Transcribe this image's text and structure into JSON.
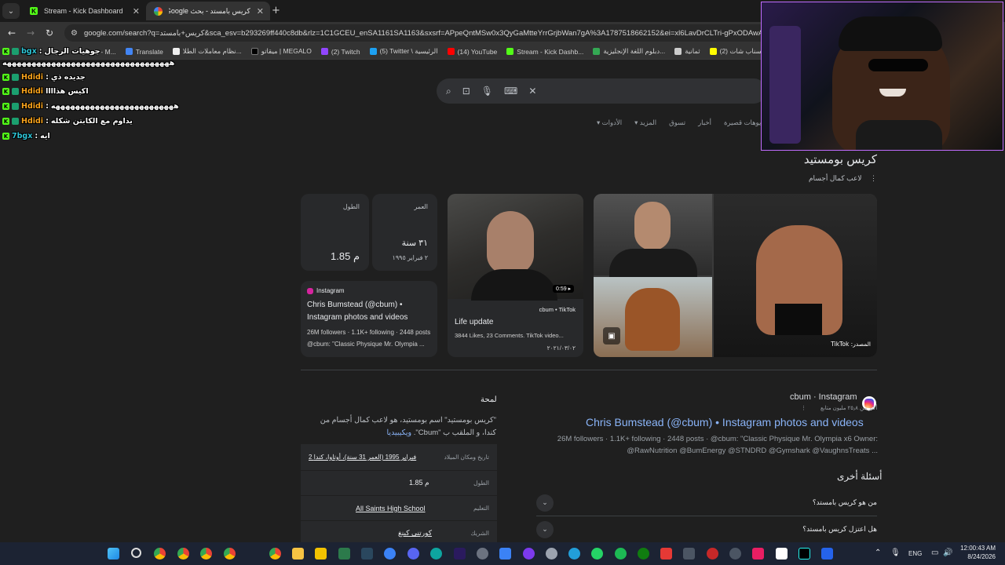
{
  "tabs": [
    {
      "title": "Stream - Kick Dashboard",
      "active": false
    },
    {
      "title": "كريس بامستد - بحث Google",
      "active": true
    }
  ],
  "address": {
    "url": "google.com/search?q=كريس+بامستد&sca_esv=b293269ff440c8db&rlz=1C1GCEU_enSA1161SA1163&sxsrf=APpeQntMSw0x3QyGaMtteYrrGrjbWan7gA%3A1787518662152&ei=xl6LavDrCLTri-gPxODAwA8&biw="
  },
  "bookmarks": [
    "ents - M...",
    "Translate",
    "نظام معاملات الطلا...",
    "ميقاتو | MEGALO",
    "(2) Twitch",
    "(5) Twitter \\ الرئيسية",
    "(14) YouTube",
    "Stream - Kick Dashb...",
    "دبلوم اللغة الإنجليزية...",
    "ثمانية",
    "(2) سناب شات"
  ],
  "chat": [
    {
      "user": "bgx",
      "text": "جوهيات الرجال"
    },
    {
      "user": "",
      "text": "ههههههههههههههههههههههههههههههههههه"
    },
    {
      "user": "Hdidi",
      "text": "جديده ذي"
    },
    {
      "user": "Hdidi",
      "text": "اكيس هذاااا"
    },
    {
      "user": "Hdidi",
      "text": "هههههههههههههههههههههههههه"
    },
    {
      "user": "Hdidi",
      "text": "يداوم مع الكابتن شكله"
    },
    {
      "user": "7bgx",
      "text": "ايه"
    }
  ],
  "chat_sep": ":",
  "filters": [
    "فيديوهات قصيرة",
    "أخبار",
    "تسوق",
    "المزيد",
    "الأدوات"
  ],
  "knowledge_panel": {
    "title": "كريس بومستيد",
    "subtitle": "لاعب كمال أجسام"
  },
  "facts": {
    "height_label": "الطول",
    "height_value": "1.85 م",
    "age_label": "العمر",
    "age_value": "٣١ سنة",
    "age_date": "٢ فبراير ١٩٩٥"
  },
  "instagram_card": {
    "source": "Instagram",
    "title": "Chris Bumstead (@cbum) • Instagram photos and videos",
    "stats": "26M followers · 1.1K+ following · 2448 posts",
    "bio": "@cbum: \"Classic Physique Mr. Olympia ..."
  },
  "tiktok_card": {
    "duration": "0:59",
    "source": "cbum • TikTok",
    "title": "Life update",
    "meta": "3844 Likes, 23 Comments. TikTok video...",
    "date": "٢٠٢١/٠٣/٠٢"
  },
  "image_caption": "TikTok :المصدر",
  "about": {
    "heading": "لمحة",
    "text": "\"كريس بومستيد\" اسم بومستيد، هو لاعب كمال أجسام من كندا، و الملقب ب \"Cbum\".",
    "link": "ويكيبيديا"
  },
  "info_rows": [
    {
      "key": "تاريخ ومكان الميلاد",
      "value": "2 فبراير 1995 (العمر 31 سنة)، أوتاوا، كندا"
    },
    {
      "key": "الطول",
      "value": "1.85 م"
    },
    {
      "key": "التعليم",
      "value": "All Saints High School"
    },
    {
      "key": "الشريك",
      "value": "كورتني كينغ"
    }
  ],
  "result": {
    "site": "cbum · Instagram",
    "meta": "أكثر من ٢٥٫٨ مليون متابع",
    "title": "Chris Bumstead (@cbum) • Instagram photos and videos",
    "snippet": "26M followers · 1.1K+ following · 2448 posts · @cbum: \"Classic Physique Mr. Olympia x6 Owner: @RawNutrition @BumEnergy @STNDRD @Gymshark @VaughnsTreats ..."
  },
  "paa": {
    "heading": "أسئلة أخرى",
    "questions": [
      "من هو كريس بامستد؟",
      "هل اعتزل كريس بامستد؟"
    ]
  },
  "taskbar": {
    "lang": "ENG",
    "time": "12:00:43 AM",
    "date": "8/24/2026"
  }
}
